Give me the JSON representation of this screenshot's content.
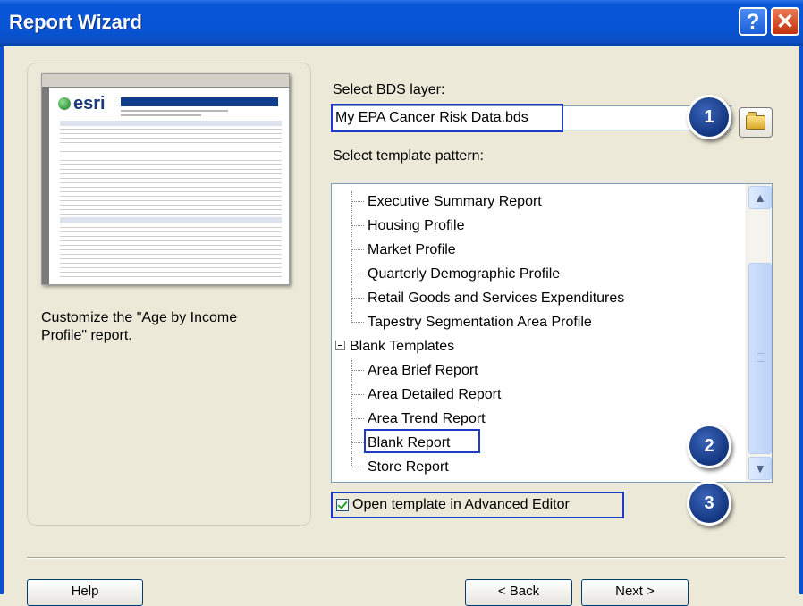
{
  "window": {
    "title": "Report Wizard",
    "help_icon": "?",
    "close_icon": "✕"
  },
  "preview": {
    "description": "Customize the \"Age by Income Profile\" report.",
    "logo_text": "esri"
  },
  "bds": {
    "label": "Select BDS layer:",
    "value": "My EPA Cancer Risk Data.bds"
  },
  "template": {
    "label": "Select template pattern:",
    "items": [
      {
        "label": "Executive Summary Report"
      },
      {
        "label": "Housing Profile"
      },
      {
        "label": "Market Profile"
      },
      {
        "label": "Quarterly Demographic Profile"
      },
      {
        "label": "Retail Goods and Services Expenditures"
      },
      {
        "label": "Tapestry Segmentation Area Profile"
      },
      {
        "label": "Blank Templates"
      },
      {
        "label": "Area Brief Report"
      },
      {
        "label": "Area Detailed Report"
      },
      {
        "label": "Area Trend Report"
      },
      {
        "label": "Blank Report"
      },
      {
        "label": "Store Report"
      }
    ]
  },
  "advanced_editor": {
    "label": "Open template in Advanced Editor",
    "checked": true
  },
  "callouts": [
    "1",
    "2",
    "3"
  ],
  "buttons": {
    "help": "Help",
    "back": "< Back",
    "next": "Next >"
  }
}
